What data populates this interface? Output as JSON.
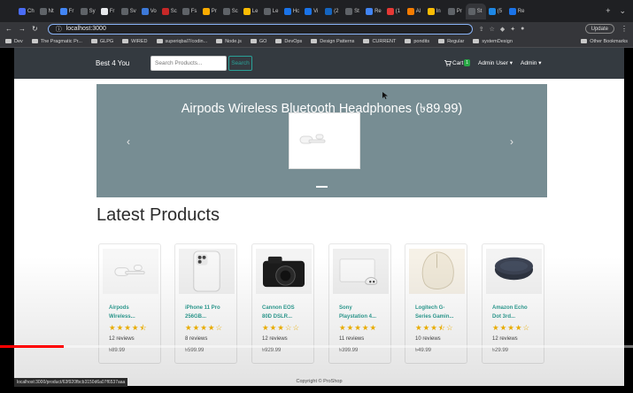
{
  "browser": {
    "tabs": [
      {
        "label": "Ch"
      },
      {
        "label": "Nt"
      },
      {
        "label": "Fr"
      },
      {
        "label": "Sy"
      },
      {
        "label": "Fr"
      },
      {
        "label": "Sv"
      },
      {
        "label": "Vo"
      },
      {
        "label": "Sc"
      },
      {
        "label": "Fs"
      },
      {
        "label": "Pr"
      },
      {
        "label": "Sc"
      },
      {
        "label": "Le"
      },
      {
        "label": "Le"
      },
      {
        "label": "Hc"
      },
      {
        "label": "Vi"
      },
      {
        "label": "(2"
      },
      {
        "label": "St"
      },
      {
        "label": "Re"
      },
      {
        "label": "(1"
      },
      {
        "label": "Al"
      },
      {
        "label": "In"
      },
      {
        "label": "Pr"
      },
      {
        "label": "St"
      },
      {
        "label": "(5"
      },
      {
        "label": "Re"
      }
    ],
    "new_tab_label": "+",
    "url": "localhost:3000",
    "update_label": "Update",
    "bookmarks": [
      {
        "label": "Dev"
      },
      {
        "label": "The Pragmatic Pr..."
      },
      {
        "label": "GLPG"
      },
      {
        "label": "WIRED"
      },
      {
        "label": "superiqbal7/codin..."
      },
      {
        "label": "Node.js"
      },
      {
        "label": "GO"
      },
      {
        "label": "DevOps"
      },
      {
        "label": "Design Patterns"
      },
      {
        "label": "CURRENT"
      },
      {
        "label": "pondits"
      },
      {
        "label": "Regular"
      },
      {
        "label": "systemDesign"
      }
    ],
    "other_bookmarks": "Other Bookmarks",
    "status_url": "localhost:3000/product/63f920fbcb3150d6a07f6537aaa"
  },
  "navbar": {
    "brand": "Best 4 You",
    "search_placeholder": "Search Products...",
    "search_button": "Search",
    "cart_label": "Cart",
    "cart_count": "1",
    "admin_user": "Admin User",
    "admin_menu": "Admin"
  },
  "carousel": {
    "title": "Airpods Wireless Bluetooth Headphones (৳89.99)",
    "prev_icon": "‹",
    "next_icon": "›"
  },
  "section_title": "Latest Products",
  "products": [
    {
      "name_line1": "Airpods",
      "name_line2": "Wireless...",
      "rating": 4.5,
      "reviews": "12 reviews",
      "price": "৳89.99",
      "image": "airpods"
    },
    {
      "name_line1": "iPhone 11 Pro",
      "name_line2": "256GB...",
      "rating": 4,
      "reviews": "8 reviews",
      "price": "৳599.99",
      "image": "iphone"
    },
    {
      "name_line1": "Cannon EOS",
      "name_line2": "80D DSLR...",
      "rating": 3,
      "reviews": "12 reviews",
      "price": "৳929.99",
      "image": "camera"
    },
    {
      "name_line1": "Sony",
      "name_line2": "Playstation 4...",
      "rating": 5,
      "reviews": "11 reviews",
      "price": "৳399.99",
      "image": "playstation"
    },
    {
      "name_line1": "Logitech G-",
      "name_line2": "Series Gamin...",
      "rating": 3.5,
      "reviews": "10 reviews",
      "price": "৳49.99",
      "image": "mouse"
    },
    {
      "name_line1": "Amazon Echo",
      "name_line2": "Dot 3rd...",
      "rating": 4,
      "reviews": "12 reviews",
      "price": "৳29.99",
      "image": "echo-dot"
    }
  ],
  "footer_text": "Copyright © ProShop",
  "video": {
    "progress": 0.1
  },
  "colors": {
    "navbar": "#343a40",
    "accent": "#2f9e93",
    "star": "#f8b700",
    "carousel": "#778d93",
    "progress": "#ff0000"
  }
}
